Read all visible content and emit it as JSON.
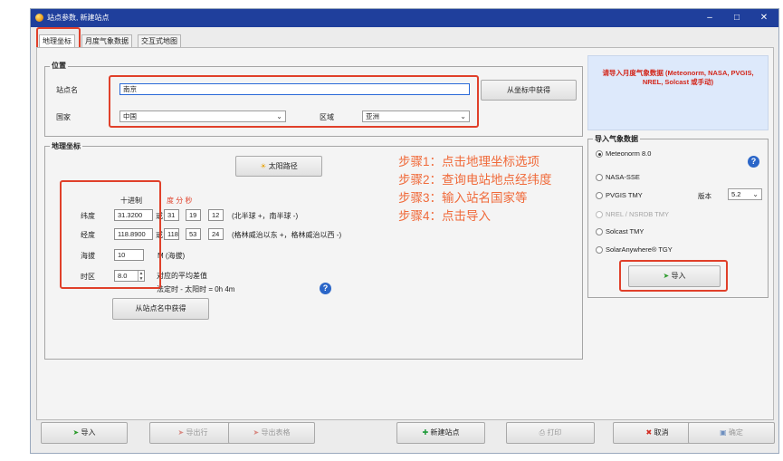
{
  "window": {
    "title": "站点参数, 新建站点"
  },
  "tabs": [
    {
      "label": "地理坐标"
    },
    {
      "label": "月度气象数据"
    },
    {
      "label": "交互式地图"
    }
  ],
  "location": {
    "group_label": "位置",
    "site_name_label": "站点名",
    "site_name_value": "南京",
    "country_label": "国家",
    "country_value": "中国",
    "region_label": "区域",
    "region_value": "亚洲",
    "from_coords_button": "从坐标中获得"
  },
  "import_note": "请导入月度气象数据 (Meteonorm, NASA, PVGIS, NREL, Solcast 或手动)",
  "geo": {
    "group_label": "地理坐标",
    "sun_path_button": "太阳路径",
    "decimal_header": "十进制",
    "dms_header": "度 分 秒",
    "latitude_label": "纬度",
    "latitude_value": "31.3200",
    "latitude_dms": [
      "31",
      "19",
      "12"
    ],
    "latitude_hint": "(北半球 +，南半球 -)",
    "longitude_label": "经度",
    "longitude_value": "118.8900",
    "longitude_dms": [
      "118",
      "53",
      "24"
    ],
    "longitude_hint": "(格林威治以东 +，格林威治以西 -)",
    "altitude_label": "海拔",
    "altitude_value": "10",
    "altitude_unit": "M (海拔)",
    "timezone_label": "时区",
    "timezone_value": "8.0",
    "timezone_note": "对应的平均差值",
    "solar_time_note": "法定时 - 太阳时 = 0h 4m",
    "from_site_button": "从站点名中获得",
    "dms_prefix": "或"
  },
  "steps": [
    "步骤1：点击地理坐标选项",
    "步骤2：查询电站地点经纬度",
    "步骤3：输入站名国家等",
    "步骤4：点击导入"
  ],
  "import_weather": {
    "group_label": "导入气象数据",
    "options": [
      {
        "label": "Meteonorm 8.0",
        "selected": true,
        "enabled": true
      },
      {
        "label": "NASA-SSE",
        "selected": false,
        "enabled": true
      },
      {
        "label": "PVGIS TMY",
        "selected": false,
        "enabled": true
      },
      {
        "label": "NREL / NSRDB TMY",
        "selected": false,
        "enabled": false
      },
      {
        "label": "Solcast TMY",
        "selected": false,
        "enabled": true
      },
      {
        "label": "SolarAnywhere® TGY",
        "selected": false,
        "enabled": true
      }
    ],
    "version_label": "版本",
    "version_value": "5.2",
    "import_button": "导入"
  },
  "bottom_bar": {
    "import": "导入",
    "export_site": "导出行",
    "export_table": "导出表格",
    "new_site": "新建站点",
    "print": "打印",
    "cancel": "取消",
    "ok": "确定"
  },
  "colors": {
    "titlebar": "#1f3f9c",
    "annotation": "#e0402a",
    "steps_text": "#f06a3a",
    "note_text": "#d3271b",
    "note_bg": "#dde9fb"
  }
}
